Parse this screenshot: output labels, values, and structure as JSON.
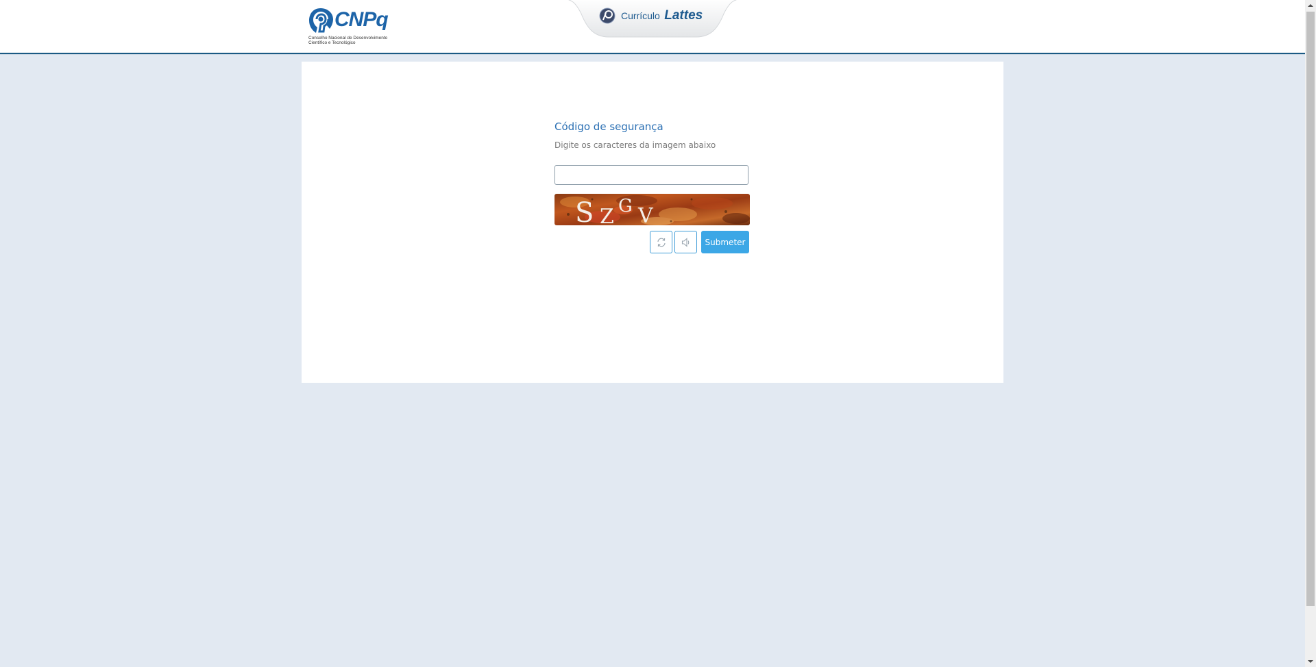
{
  "header": {
    "logo_text": "CNPq",
    "logo_subtitle_line1": "Conselho Nacional de Desenvolvimento",
    "logo_subtitle_line2": "Científico e Tecnológico",
    "app_tab_prefix": "Currículo",
    "app_tab_name": "Lattes"
  },
  "form": {
    "title": "Código de segurança",
    "subtitle": "Digite os caracteres da imagem abaixo",
    "input_value": "",
    "captcha_text": "SZGV",
    "refresh_icon": "refresh-icon",
    "audio_icon": "speaker-icon",
    "submit_label": "Submeter"
  },
  "colors": {
    "background": "#e2e9f2",
    "title": "#2a6fb3",
    "accent": "#3ca7e6",
    "header_rule": "#1b5a84"
  }
}
